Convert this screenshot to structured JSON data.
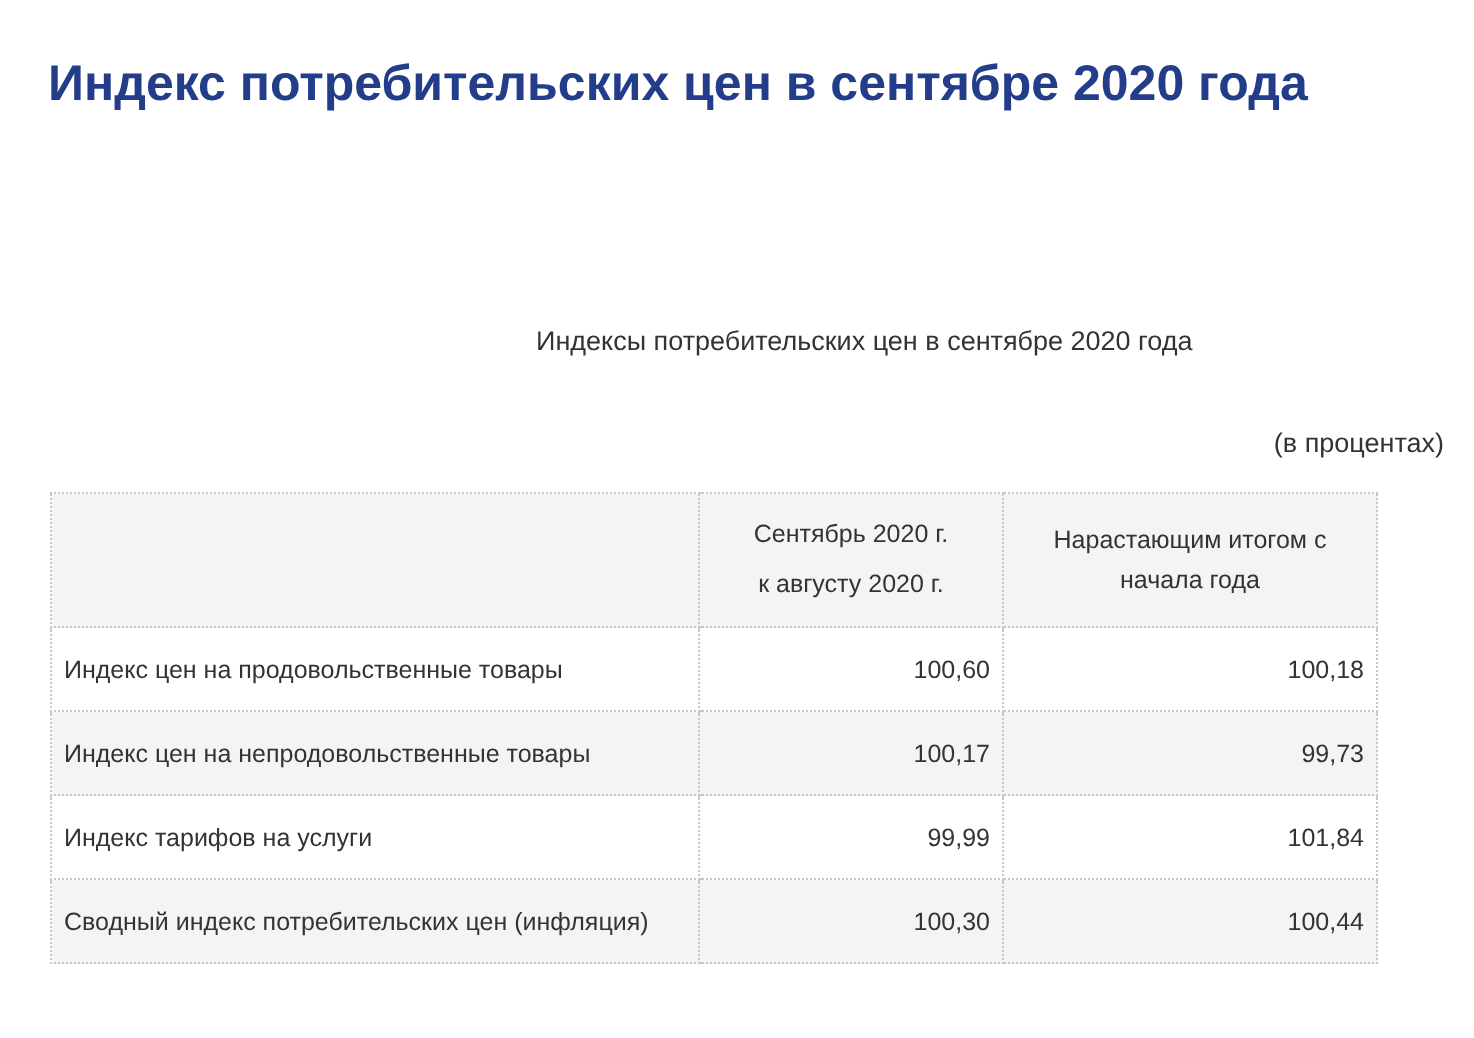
{
  "title": "Индекс потребительских цен в сентябре 2020 года",
  "table_caption": "Индексы потребительских цен в сентябре 2020 года",
  "units": "(в процентах)",
  "table": {
    "columns": [
      {
        "lines": [
          "Сентябрь 2020 г.",
          "к августу 2020 г."
        ]
      },
      {
        "lines": [
          "Нарастающим итогом с",
          "начала года"
        ]
      }
    ],
    "rows": [
      {
        "label": "Индекс цен на продовольственные товары",
        "values": [
          "100,60",
          "100,18"
        ]
      },
      {
        "label": "Индекс цен на непродовольственные товары",
        "values": [
          "100,17",
          "99,73"
        ]
      },
      {
        "label": "Индекс тарифов на услуги",
        "values": [
          "99,99",
          "101,84"
        ]
      },
      {
        "label": "Сводный индекс потребительских цен (инфляция)",
        "values": [
          "100,30",
          "100,44"
        ]
      }
    ]
  }
}
